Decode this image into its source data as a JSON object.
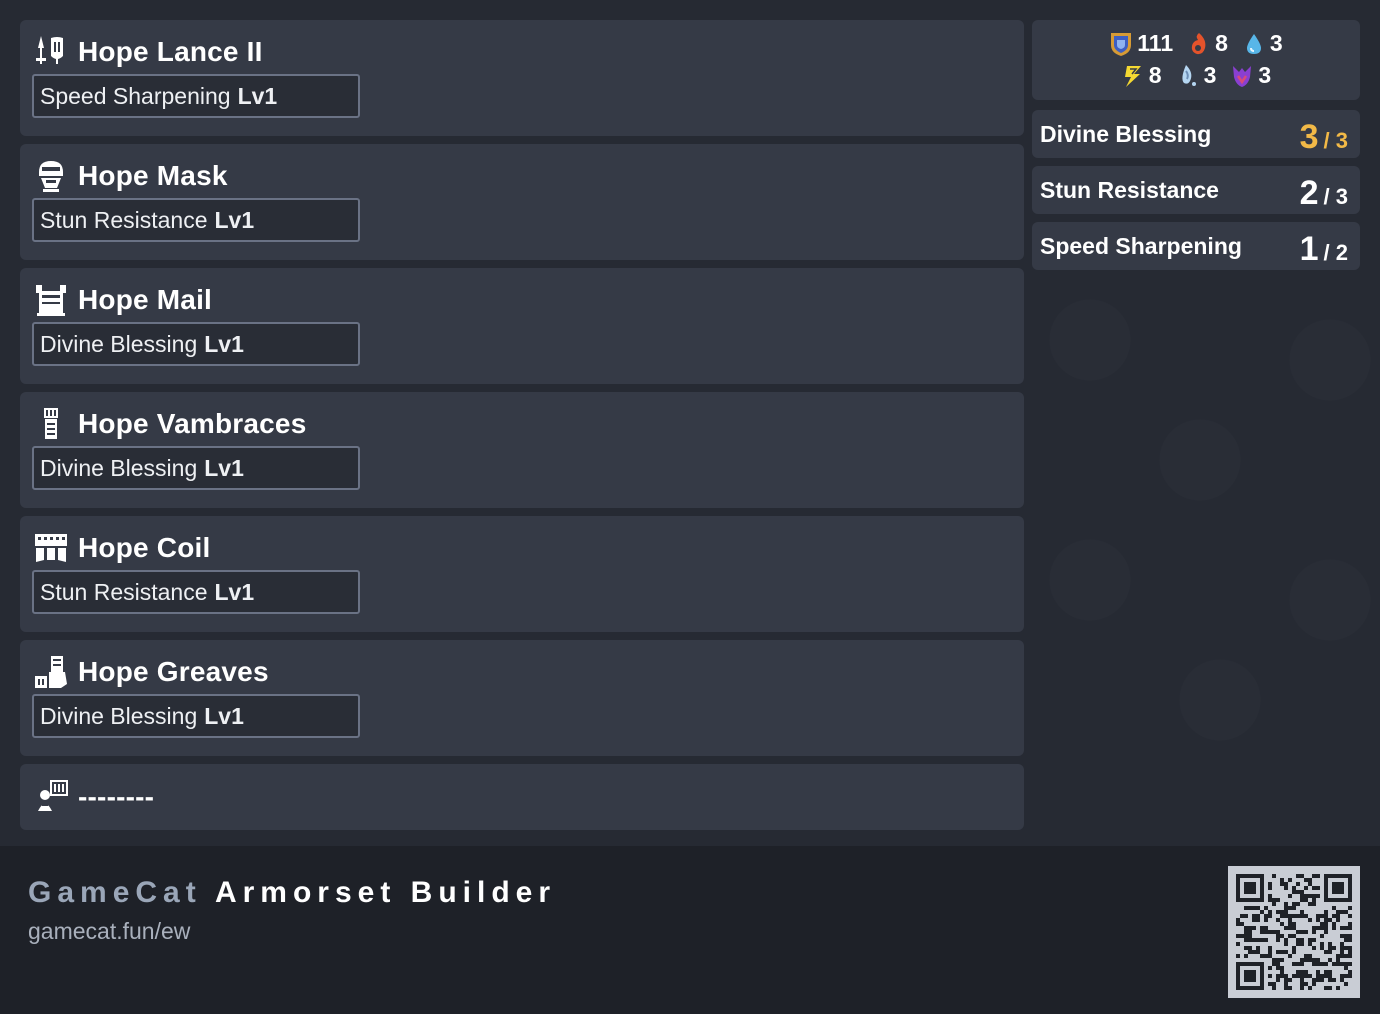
{
  "stats": {
    "defense": "111",
    "fire": "8",
    "water": "3",
    "thunder": "8",
    "ice": "3",
    "dragon": "3"
  },
  "equipment": [
    {
      "slot": "weapon",
      "icon": "lance-icon",
      "name": "Hope Lance II",
      "skill": "Speed Sharpening",
      "level": "Lv1"
    },
    {
      "slot": "head",
      "icon": "helm-icon",
      "name": "Hope Mask",
      "skill": "Stun Resistance",
      "level": "Lv1"
    },
    {
      "slot": "chest",
      "icon": "chest-icon",
      "name": "Hope Mail",
      "skill": "Divine Blessing",
      "level": "Lv1"
    },
    {
      "slot": "arms",
      "icon": "arms-icon",
      "name": "Hope Vambraces",
      "skill": "Divine Blessing",
      "level": "Lv1"
    },
    {
      "slot": "waist",
      "icon": "waist-icon",
      "name": "Hope Coil",
      "skill": "Stun Resistance",
      "level": "Lv1"
    },
    {
      "slot": "legs",
      "icon": "legs-icon",
      "name": "Hope Greaves",
      "skill": "Divine Blessing",
      "level": "Lv1"
    },
    {
      "slot": "talisman",
      "icon": "talisman-icon",
      "name": "--------"
    }
  ],
  "skills": [
    {
      "name": "Divine Blessing",
      "current": "3",
      "max": "/ 3",
      "maxed": true
    },
    {
      "name": "Stun Resistance",
      "current": "2",
      "max": "/ 3",
      "maxed": false
    },
    {
      "name": "Speed Sharpening",
      "current": "1",
      "max": "/ 2",
      "maxed": false
    }
  ],
  "footer": {
    "brand_prefix": "GameCat",
    "brand_suffix": "Armorset Builder",
    "url": "gamecat.fun/ew"
  },
  "colors": {
    "background": "#262a33",
    "card": "#353a46",
    "footer": "#1e2128",
    "maxed_skill": "#f2b947"
  }
}
